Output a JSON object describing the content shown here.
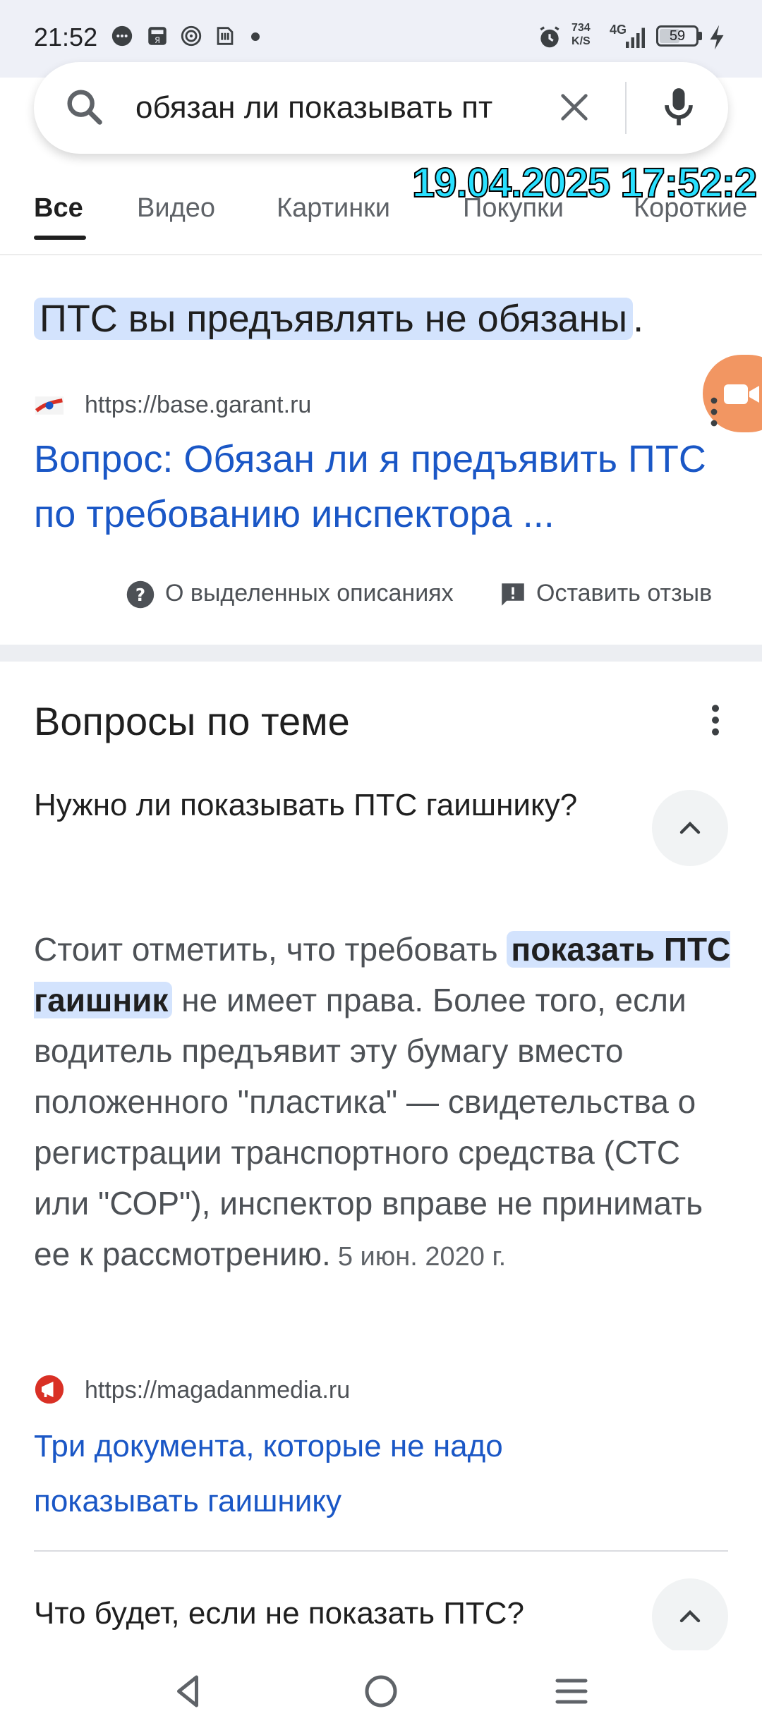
{
  "status_bar": {
    "time": "21:52",
    "speed_value": "734",
    "speed_unit": "K/S",
    "network": "4G",
    "battery_level": "59",
    "battery_fraction": 0.59
  },
  "search": {
    "query": "обязан ли показывать пт"
  },
  "overlay": {
    "timestamp": "19.04.2025 17:52:2"
  },
  "tabs": [
    "Все",
    "Видео",
    "Картинки",
    "Покупки",
    "Короткие"
  ],
  "snippet": {
    "answer_highlight": "ПТС вы предъявлять не обязаны",
    "answer_tail": ".",
    "source_url": "https://base.garant.ru",
    "link_title": "Вопрос: Обязан ли я предъявить ПТС по требованию инспектора ...",
    "about_label": "О выделенных описаниях",
    "feedback_label": "Оставить отзыв"
  },
  "related": {
    "title": "Вопросы по теме",
    "q1": "Нужно ли показывать ПТС гаишнику?",
    "a1_before": "Стоит отметить, что требовать ",
    "a1_highlight": "показать ПТС гаишник",
    "a1_after": " не имеет права. Более того, если водитель предъявит эту бумагу вместо положенного \"пластика\" — свидетельства о регистрации транспортного средства (СТС или \"СОР\"), инспектор вправе не принимать ее к рассмотрению.",
    "a1_date": "5 июн. 2020 г.",
    "a1_source_url": "https://magadanmedia.ru",
    "a1_link_title": "Три документа, которые не надо показывать гаишнику",
    "q2": "Что будет, если не показать ПТС?"
  },
  "colors": {
    "link": "#1a57c6",
    "highlight": "#d3e3fd",
    "floating_button": "#f29662"
  }
}
